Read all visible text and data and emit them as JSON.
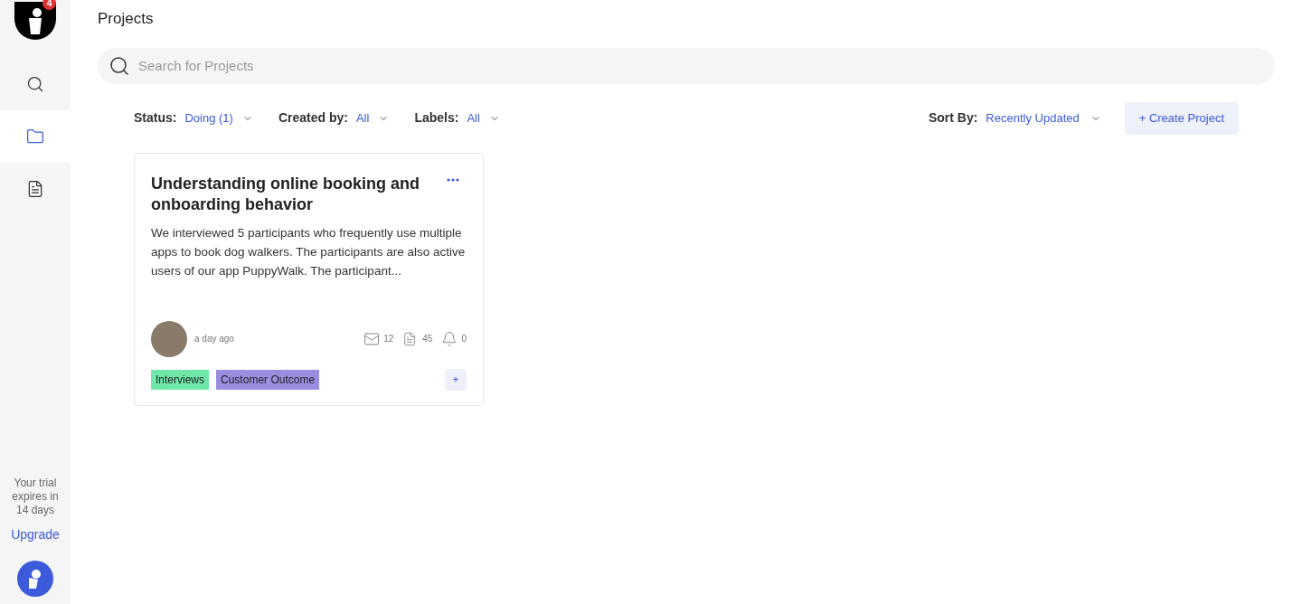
{
  "sidebar": {
    "badge": "4",
    "items": [
      {
        "kind": "search",
        "selected": false
      },
      {
        "kind": "folder",
        "selected": true
      },
      {
        "kind": "document",
        "selected": false
      }
    ],
    "trial_text": "Your trial expires in 14 days",
    "upgrade": "Upgrade"
  },
  "page_title": "Projects",
  "search": {
    "placeholder": "Search for Projects"
  },
  "filters": [
    {
      "label": "Status:",
      "value": "Doing (1)"
    },
    {
      "label": "Created by:",
      "value": "All"
    },
    {
      "label": "Labels:",
      "value": "All"
    }
  ],
  "sort": {
    "label": "Sort By:",
    "value": "Recently Updated"
  },
  "create_button": "+ Create Project",
  "projects": [
    {
      "title": "Understanding online booking and onboarding behavior",
      "description": "We interviewed 5 participants who frequently use multiple apps to book dog walkers. The participants are also active users of our app PuppyWalk. The participant...",
      "time": "a day ago",
      "messages": "12",
      "notes": "45",
      "alerts": "0",
      "tags": [
        {
          "label": "Interviews",
          "color": "#6ee7a8"
        },
        {
          "label": "Customer Outcome",
          "color": "#9b8ee0"
        }
      ],
      "add": "+"
    }
  ]
}
